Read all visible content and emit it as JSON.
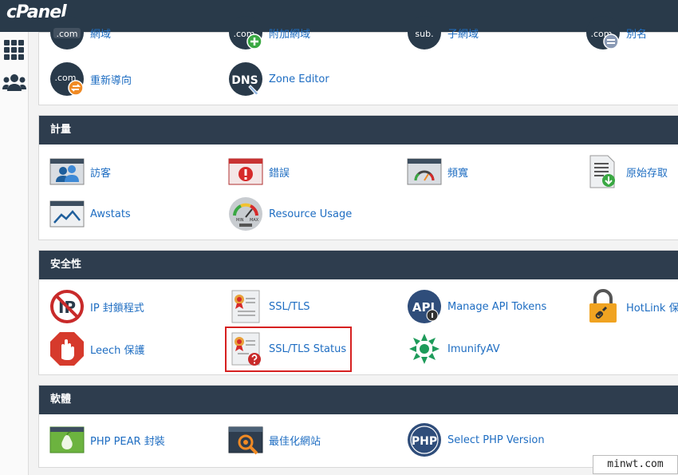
{
  "app": {
    "logo": "cPanel"
  },
  "sidebar": {
    "items": [
      {
        "icon": "apps-grid-icon"
      },
      {
        "icon": "users-icon"
      }
    ]
  },
  "sections": {
    "domains": {
      "items": [
        {
          "label": "網域",
          "icon": "domain-com-icon"
        },
        {
          "label": "附加網域",
          "icon": "addon-domain-icon"
        },
        {
          "label": "子網域",
          "icon": "subdomain-icon"
        },
        {
          "label": "別名",
          "icon": "alias-domain-icon"
        },
        {
          "label": "重新導向",
          "icon": "redirects-icon"
        },
        {
          "label": "Zone Editor",
          "icon": "dns-zone-editor-icon",
          "badge": "DNS"
        }
      ]
    },
    "metrics": {
      "title": "計量",
      "items": [
        {
          "label": "訪客",
          "icon": "visitors-icon"
        },
        {
          "label": "錯誤",
          "icon": "errors-icon"
        },
        {
          "label": "頻寬",
          "icon": "bandwidth-icon"
        },
        {
          "label": "原始存取",
          "icon": "raw-access-icon"
        },
        {
          "label": "Awstats",
          "icon": "awstats-icon"
        },
        {
          "label": "Resource Usage",
          "icon": "resource-usage-icon"
        }
      ]
    },
    "security": {
      "title": "安全性",
      "items": [
        {
          "label": "IP 封鎖程式",
          "icon": "ip-blocker-icon"
        },
        {
          "label": "SSL/TLS",
          "icon": "ssl-tls-icon"
        },
        {
          "label": "Manage API Tokens",
          "icon": "api-tokens-icon",
          "badge": "API"
        },
        {
          "label": "HotLink 保護",
          "icon": "hotlink-lock-icon"
        },
        {
          "label": "Leech 保護",
          "icon": "leech-protect-icon"
        },
        {
          "label": "SSL/TLS Status",
          "icon": "ssl-tls-status-icon"
        },
        {
          "label": "ImunifyAV",
          "icon": "imunifyav-icon"
        }
      ]
    },
    "software": {
      "title": "軟體",
      "items": [
        {
          "label": "PHP PEAR 封裝",
          "icon": "php-pear-icon"
        },
        {
          "label": "最佳化網站",
          "icon": "optimize-website-icon"
        },
        {
          "label": "Select PHP Version",
          "icon": "php-version-icon",
          "badge": "PHP"
        }
      ]
    }
  },
  "icon_text": {
    "com": ".com",
    "sub": "sub.",
    "min": "MIN",
    "max": "MAX",
    "ip": "IP"
  },
  "watermark": "minwt.com"
}
